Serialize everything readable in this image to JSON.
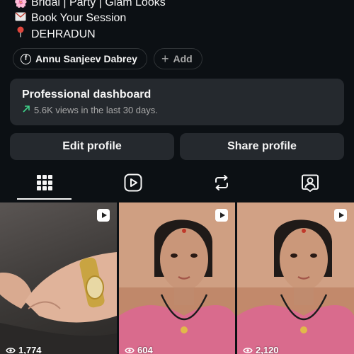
{
  "bio": {
    "lines": [
      {
        "icon": "cherry-blossom-icon",
        "text": "Bridal | Party | Glam Looks"
      },
      {
        "icon": "envelope-icon",
        "text": "Book Your Session"
      },
      {
        "icon": "pin-icon",
        "text": "DEHRADUN"
      }
    ]
  },
  "chips": {
    "facebook_name": "Annu Sanjeev Dabrey",
    "add_label": "Add"
  },
  "dashboard": {
    "title": "Professional dashboard",
    "subtitle": "5.6K views in the last 30 days."
  },
  "buttons": {
    "edit": "Edit profile",
    "share": "Share profile"
  },
  "tabs": [
    {
      "icon": "grid-icon",
      "active": true
    },
    {
      "icon": "reels-icon",
      "active": false
    },
    {
      "icon": "repost-icon",
      "active": false
    },
    {
      "icon": "tagged-icon",
      "active": false
    }
  ],
  "posts": [
    {
      "views": "1,774",
      "type": "reel"
    },
    {
      "views": "604",
      "type": "reel"
    },
    {
      "views": "2,120",
      "type": "reel"
    }
  ],
  "colors": {
    "background": "#0c1014",
    "card": "#25292e",
    "trend_green": "#3fd28a",
    "muted_text": "#a8a8a8"
  }
}
